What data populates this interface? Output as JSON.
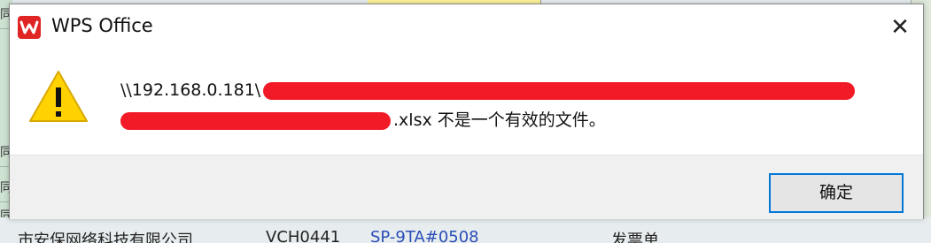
{
  "background": {
    "left_cells": [
      "同",
      "同",
      "同",
      "同"
    ],
    "bottom_fragments": [
      "市安保网络科技有限公司",
      "VCH0441",
      "SP-9TA#0508",
      "发票单"
    ]
  },
  "dialog": {
    "title": "WPS Office",
    "app_logo_icon": "wps-logo-icon",
    "close_label": "✕",
    "icon": "warning-icon",
    "message": {
      "path_prefix": "\\\\192.168.0.181\\",
      "line2_suffix": ".xlsx 不是一个有效的文件。"
    },
    "ok_label": "确定"
  },
  "colors": {
    "warning_fill": "#ffd200",
    "redaction": "#f21a27",
    "button_focus_border": "#0078d7",
    "wps_red": "#e02323"
  }
}
